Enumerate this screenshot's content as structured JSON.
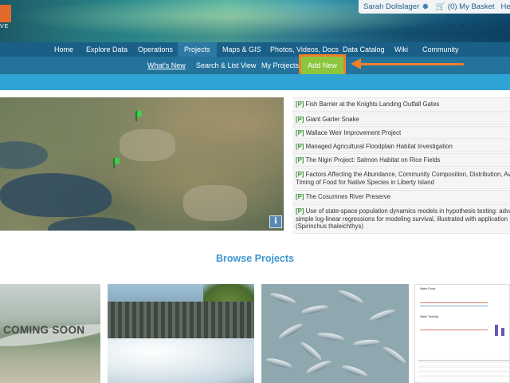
{
  "header": {
    "logo_text": "VE",
    "user": {
      "name": "Sarah Dolislager",
      "basket": "(0) My Basket",
      "help": "Help"
    }
  },
  "main_nav": {
    "items": [
      "Home",
      "Explore Data",
      "Operations",
      "Projects",
      "Maps & GIS",
      "Photos, Videos, Docs",
      "Data Catalog",
      "Wiki",
      "Community"
    ],
    "active": "Projects"
  },
  "sub_nav": {
    "items": [
      "What's New",
      "Search & List View",
      "My Projects",
      "Add New"
    ],
    "highlighted": "Add New",
    "highlight_color": "#8cc63f",
    "annotation_color": "#f07f2a"
  },
  "map": {
    "info_label": "i"
  },
  "projects": {
    "tag": "[P]",
    "items": [
      "Fish Barrier at the Knights Landing Outfall Gates",
      "Giant Garter Snake",
      "Wallace Weir Improvement Project",
      "Managed Agricultural Floodplain Habitat Investigation",
      "The Nigiri Project: Salmon Habitat on Rice Fields",
      "Factors Affecting the Abundance, Community Composition, Distribution, Av",
      "Timing of Food for Native Species in Liberty Island",
      "The Cosumnes River Preserve",
      "Use of state-space population dynamics models in hypothesis testing: advan",
      "simple log-linear regressions for modeling survival, illustrated with application",
      "(Spirinchus thaleichthys)"
    ]
  },
  "browse": {
    "title": "Browse Projects",
    "thumbs": [
      {
        "overlay": "COMING SOON"
      },
      {
        "overlay": ""
      },
      {
        "overlay": ""
      },
      {
        "chart_titles": [
          "Water Flows",
          "Water Turbidity"
        ]
      }
    ]
  },
  "colors": {
    "nav_dark": "#1a5f87",
    "nav_sub": "#24739d",
    "band": "#2fa3d3",
    "browse_title": "#3b96cf",
    "tag_green": "#3a8f34"
  }
}
